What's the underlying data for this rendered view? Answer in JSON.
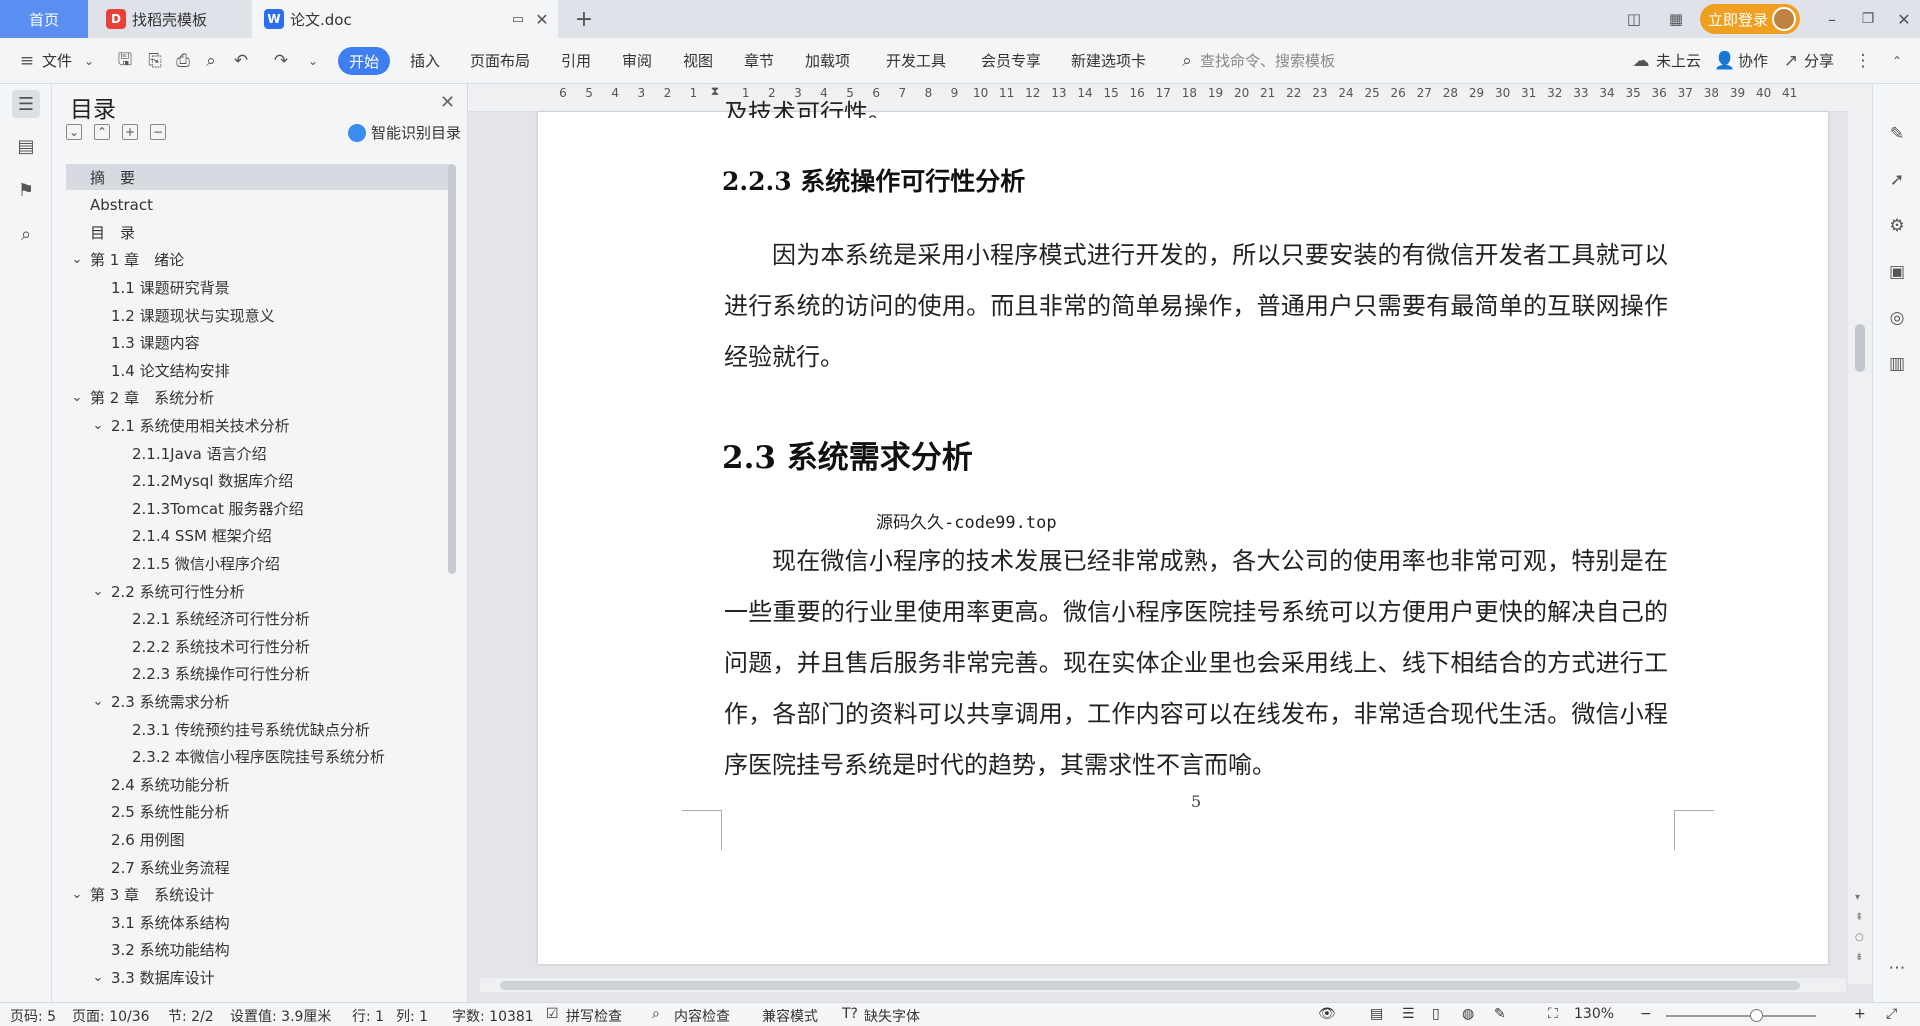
{
  "tabs": {
    "home": "首页",
    "template": "找稻壳模板",
    "doc": "论文.doc"
  },
  "titlebar": {
    "login": "立即登录"
  },
  "ribbon": {
    "file": "文件",
    "start": "开始",
    "menus": [
      "插入",
      "页面布局",
      "引用",
      "审阅",
      "视图",
      "章节",
      "加载项",
      "开发工具",
      "会员专享",
      "新建选项卡"
    ],
    "search_placeholder": "查找命令、搜索模板",
    "cloud": "未上云",
    "collab": "协作",
    "share": "分享"
  },
  "toc": {
    "title": "目录",
    "smart": "智能识别目录",
    "items": [
      {
        "text": "摘　要",
        "level": 0,
        "chevron": false,
        "selected": true
      },
      {
        "text": "Abstract",
        "level": 0,
        "chevron": false
      },
      {
        "text": "目　录",
        "level": 0,
        "chevron": false
      },
      {
        "text": "第 1 章　绪论",
        "level": 0,
        "chevron": true
      },
      {
        "text": "1.1 课题研究背景",
        "level": 1,
        "chevron": false
      },
      {
        "text": "1.2 课题现状与实现意义",
        "level": 1,
        "chevron": false
      },
      {
        "text": "1.3 课题内容",
        "level": 1,
        "chevron": false
      },
      {
        "text": "1.4 论文结构安排",
        "level": 1,
        "chevron": false
      },
      {
        "text": "第 2 章　系统分析",
        "level": 0,
        "chevron": true
      },
      {
        "text": "2.1 系统使用相关技术分析",
        "level": 1,
        "chevron": true
      },
      {
        "text": "2.1.1Java 语言介绍",
        "level": 2,
        "chevron": false
      },
      {
        "text": "2.1.2Mysql 数据库介绍",
        "level": 2,
        "chevron": false
      },
      {
        "text": "2.1.3Tomcat 服务器介绍",
        "level": 2,
        "chevron": false
      },
      {
        "text": "2.1.4 SSM 框架介绍",
        "level": 2,
        "chevron": false
      },
      {
        "text": "2.1.5 微信小程序介绍",
        "level": 2,
        "chevron": false
      },
      {
        "text": "2.2 系统可行性分析",
        "level": 1,
        "chevron": true
      },
      {
        "text": "2.2.1 系统经济可行性分析",
        "level": 2,
        "chevron": false
      },
      {
        "text": "2.2.2 系统技术可行性分析",
        "level": 2,
        "chevron": false
      },
      {
        "text": "2.2.3 系统操作可行性分析",
        "level": 2,
        "chevron": false
      },
      {
        "text": "2.3 系统需求分析",
        "level": 1,
        "chevron": true
      },
      {
        "text": "2.3.1 传统预约挂号系统优缺点分析",
        "level": 2,
        "chevron": false
      },
      {
        "text": "2.3.2 本微信小程序医院挂号系统分析",
        "level": 2,
        "chevron": false
      },
      {
        "text": "2.4 系统功能分析",
        "level": 1,
        "chevron": false
      },
      {
        "text": "2.5 系统性能分析",
        "level": 1,
        "chevron": false
      },
      {
        "text": "2.6 用例图",
        "level": 1,
        "chevron": false
      },
      {
        "text": "2.7 系统业务流程",
        "level": 1,
        "chevron": false
      },
      {
        "text": "第 3 章　系统设计",
        "level": 0,
        "chevron": true
      },
      {
        "text": "3.1 系统体系结构",
        "level": 1,
        "chevron": false
      },
      {
        "text": "3.2 系统功能结构",
        "level": 1,
        "chevron": false
      },
      {
        "text": "3.3 数据库设计",
        "level": 1,
        "chevron": true
      }
    ]
  },
  "ruler": {
    "numbers": [
      "6",
      "5",
      "4",
      "3",
      "2",
      "1",
      "",
      "1",
      "2",
      "3",
      "4",
      "5",
      "6",
      "7",
      "8",
      "9",
      "10",
      "11",
      "12",
      "13",
      "14",
      "15",
      "16",
      "17",
      "18",
      "19",
      "20",
      "21",
      "22",
      "23",
      "24",
      "25",
      "26",
      "27",
      "28",
      "29",
      "30",
      "31",
      "32",
      "33",
      "34",
      "35",
      "36",
      "37",
      "38",
      "39",
      "40",
      "41"
    ]
  },
  "document": {
    "top_fragment": "及技术可行性。",
    "h3": "2.2.3 系统操作可行性分析",
    "para1": "因为本系统是采用小程序模式进行开发的，所以只要安装的有微信开发者工具就可以进行系统的访问的使用。而且非常的简单易操作，普通用户只需要有最简单的互联网操作经验就行。",
    "h2": "2.3 系统需求分析",
    "watermark": "源码久久-code99.top",
    "para2": "现在微信小程序的技术发展已经非常成熟，各大公司的使用率也非常可观，特别是在一些重要的行业里使用率更高。微信小程序医院挂号系统可以方便用户更快的解决自己的问题，并且售后服务非常完善。现在实体企业里也会采用线上、线下相结合的方式进行工作，各部门的资料可以共享调用，工作内容可以在线发布，非常适合现代生活。微信小程序医院挂号系统是时代的趋势，其需求性不言而喻。",
    "page_number": "5"
  },
  "status": {
    "page": "页码: 5",
    "pages": "页面: 10/36",
    "section": "节: 2/2",
    "setting": "设置值: 3.9厘米",
    "row": "行: 1",
    "col": "列: 1",
    "words": "字数: 10381",
    "spell": "拼写检查",
    "content_check": "内容检查",
    "compat": "兼容模式",
    "missing_font": "缺失字体",
    "zoom": "130%"
  },
  "colors": {
    "accent": "#3f7ef0",
    "home_tab": "#5a8ef0",
    "login": "#f0a020"
  }
}
